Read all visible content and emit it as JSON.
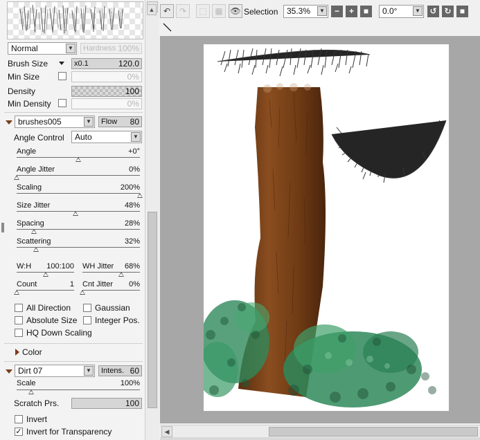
{
  "toolbar": {
    "selection_label": "Selection",
    "zoom": "35.3%",
    "rotation": "0.0°"
  },
  "blend": {
    "mode": "Normal",
    "hardness_label": "Hardness",
    "hardness_value": "100%"
  },
  "brush": {
    "size_label": "Brush Size",
    "size_multiplier": "x0.1",
    "size_value": "120.0",
    "min_size_label": "Min Size",
    "min_size_value": "0%",
    "density_label": "Density",
    "density_value": "100",
    "min_density_label": "Min Density",
    "min_density_value": "0%"
  },
  "texture": {
    "name": "brushes005",
    "flow_label": "Flow",
    "flow_value": "80",
    "angle_control_label": "Angle Control",
    "angle_control_value": "Auto"
  },
  "sliders": [
    {
      "label": "Angle",
      "value": "+0°",
      "level": 0.5
    },
    {
      "label": "Angle Jitter",
      "value": "0%",
      "level": 0.0
    },
    {
      "label": "Scaling",
      "value": "200%",
      "level": 1.0
    },
    {
      "label": "Size Jitter",
      "value": "48%",
      "level": 0.48
    },
    {
      "label": "Spacing",
      "value": "28%",
      "level": 0.14
    },
    {
      "label": "Scattering",
      "value": "32%",
      "level": 0.16
    }
  ],
  "pair_sliders": [
    {
      "label": "W:H",
      "value": "100:100",
      "level": 0.5
    },
    {
      "label": "WH Jitter",
      "value": "68%",
      "level": 0.68
    },
    {
      "label": "Count",
      "value": "1",
      "level": 0.0
    },
    {
      "label": "Cnt Jitter",
      "value": "0%",
      "level": 0.0
    }
  ],
  "options": {
    "all_direction": "All Direction",
    "gaussian": "Gaussian",
    "absolute_size": "Absolute Size",
    "integer_pos": "Integer Pos.",
    "hq_down_scaling": "HQ Down Scaling"
  },
  "color_section": "Color",
  "effect": {
    "name": "Dirt 07",
    "intensity_label": "Intens.",
    "intensity_value": "60",
    "scale_label": "Scale",
    "scale_value": "100%",
    "scale_level": 0.12,
    "scratch_label": "Scratch Prs.",
    "scratch_value": "100",
    "invert_label": "Invert",
    "invert_checked": false,
    "invert_transparency_label": "Invert for Transparency",
    "invert_transparency_checked": true
  },
  "colors": {
    "accent_triangle": "#7a3d1a",
    "canvas_bg": "#a7a7a7",
    "trunk": "#7b4519",
    "foliage": "#2f8a5b"
  }
}
